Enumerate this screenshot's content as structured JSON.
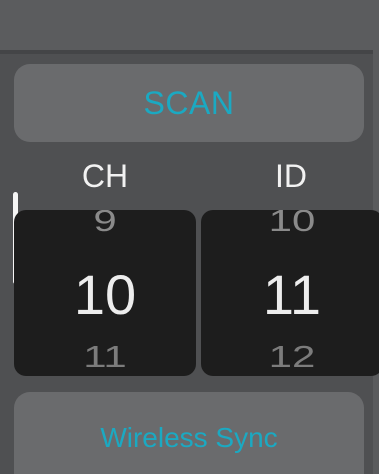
{
  "scan_button": {
    "label": "SCAN"
  },
  "channel": {
    "header": "CH",
    "previous": "9",
    "current": "10",
    "next": "11"
  },
  "id": {
    "header": "ID",
    "previous": "10",
    "current": "11",
    "next": "12"
  },
  "sync_button": {
    "label": "Wireless Sync"
  },
  "colors": {
    "accent": "#1ba9c2",
    "background": "#4f5052",
    "button": "#6a6b6d",
    "picker": "#1d1d1d"
  }
}
